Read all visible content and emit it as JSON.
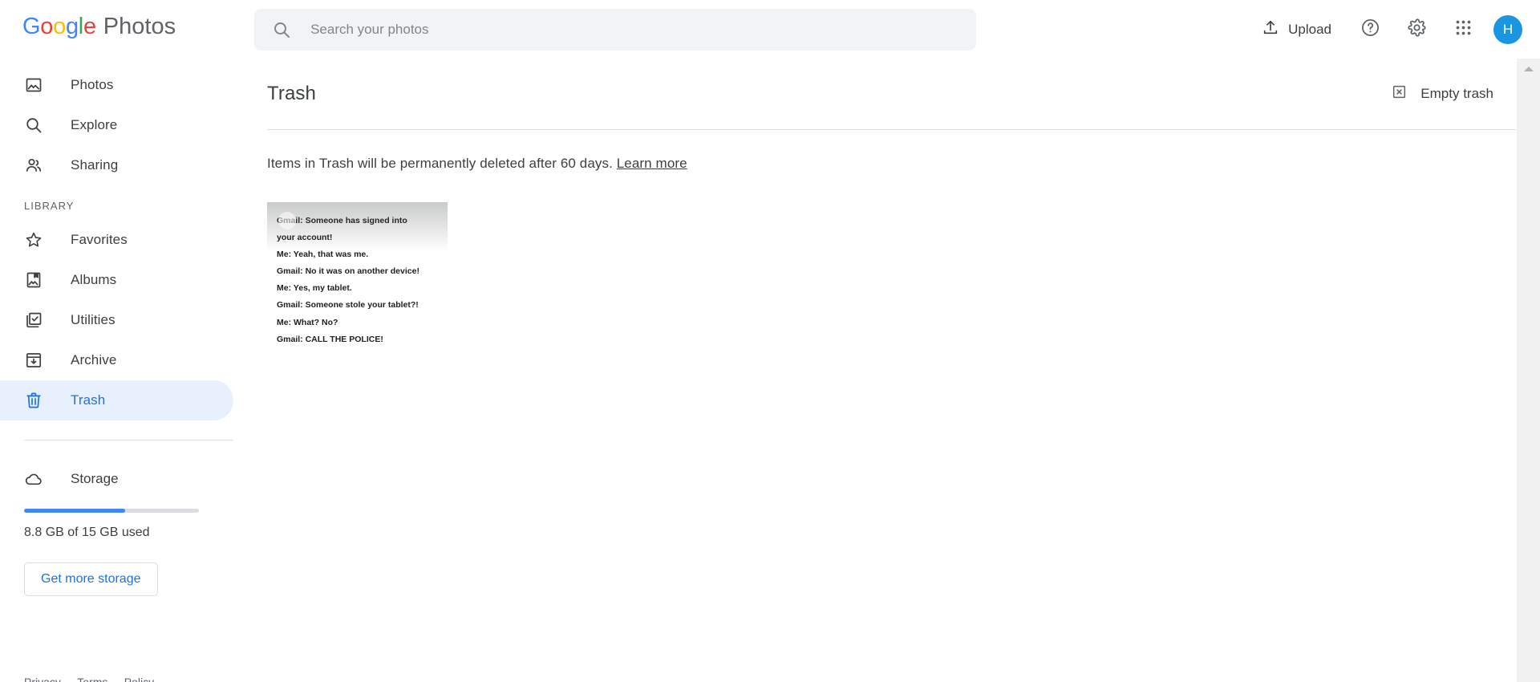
{
  "app": {
    "brand_google": "Google",
    "brand_product": "Photos",
    "brand_colors": {
      "blue": "#4285f4",
      "red": "#ea4335",
      "yellow": "#fbbc05",
      "green": "#34a853",
      "accent": "#1a73e8",
      "active_pill": "#e8f0fe"
    }
  },
  "search": {
    "placeholder": "Search your photos",
    "value": "",
    "icon": "search-icon"
  },
  "topbar": {
    "upload_label": "Upload",
    "upload_icon": "upload-icon",
    "help_icon": "help-circle-icon",
    "settings_icon": "gear-icon",
    "apps_icon": "apps-grid-icon",
    "avatar_initial": "H"
  },
  "sidebar": {
    "primary": [
      {
        "label": "Photos",
        "icon": "photo-icon",
        "active": false
      },
      {
        "label": "Explore",
        "icon": "search-icon",
        "active": false
      },
      {
        "label": "Sharing",
        "icon": "people-icon",
        "active": false
      }
    ],
    "section_label": "LIBRARY",
    "library": [
      {
        "label": "Favorites",
        "icon": "star-icon",
        "active": false
      },
      {
        "label": "Albums",
        "icon": "album-icon",
        "active": false
      },
      {
        "label": "Utilities",
        "icon": "utilities-icon",
        "active": false
      },
      {
        "label": "Archive",
        "icon": "archive-icon",
        "active": false
      },
      {
        "label": "Trash",
        "icon": "trash-icon",
        "active": true
      }
    ],
    "storage": {
      "label": "Storage",
      "icon": "cloud-icon",
      "used_text": "8.8 GB of 15 GB used",
      "used_gb": 8.8,
      "total_gb": 15,
      "percent": 58,
      "button_label": "Get more storage"
    },
    "footer": {
      "links": [
        "Privacy",
        "Terms",
        "Policy"
      ],
      "separator": "·"
    }
  },
  "main": {
    "title": "Trash",
    "empty_trash_label": "Empty trash",
    "empty_trash_icon": "delete-forever-icon",
    "notice_text": "Items in Trash will be permanently deleted after 60 days.",
    "notice_link": "Learn more",
    "items": [
      {
        "name": "gmail-conversation-meme",
        "lines": [
          "Gmail: Someone has signed into",
          "your account!",
          "Me: Yeah, that was me.",
          "Gmail: No it was on another device!",
          "Me: Yes, my tablet.",
          "Gmail: Someone stole your tablet?!",
          "Me: What? No?",
          "Gmail: CALL THE POLICE!"
        ]
      }
    ]
  }
}
